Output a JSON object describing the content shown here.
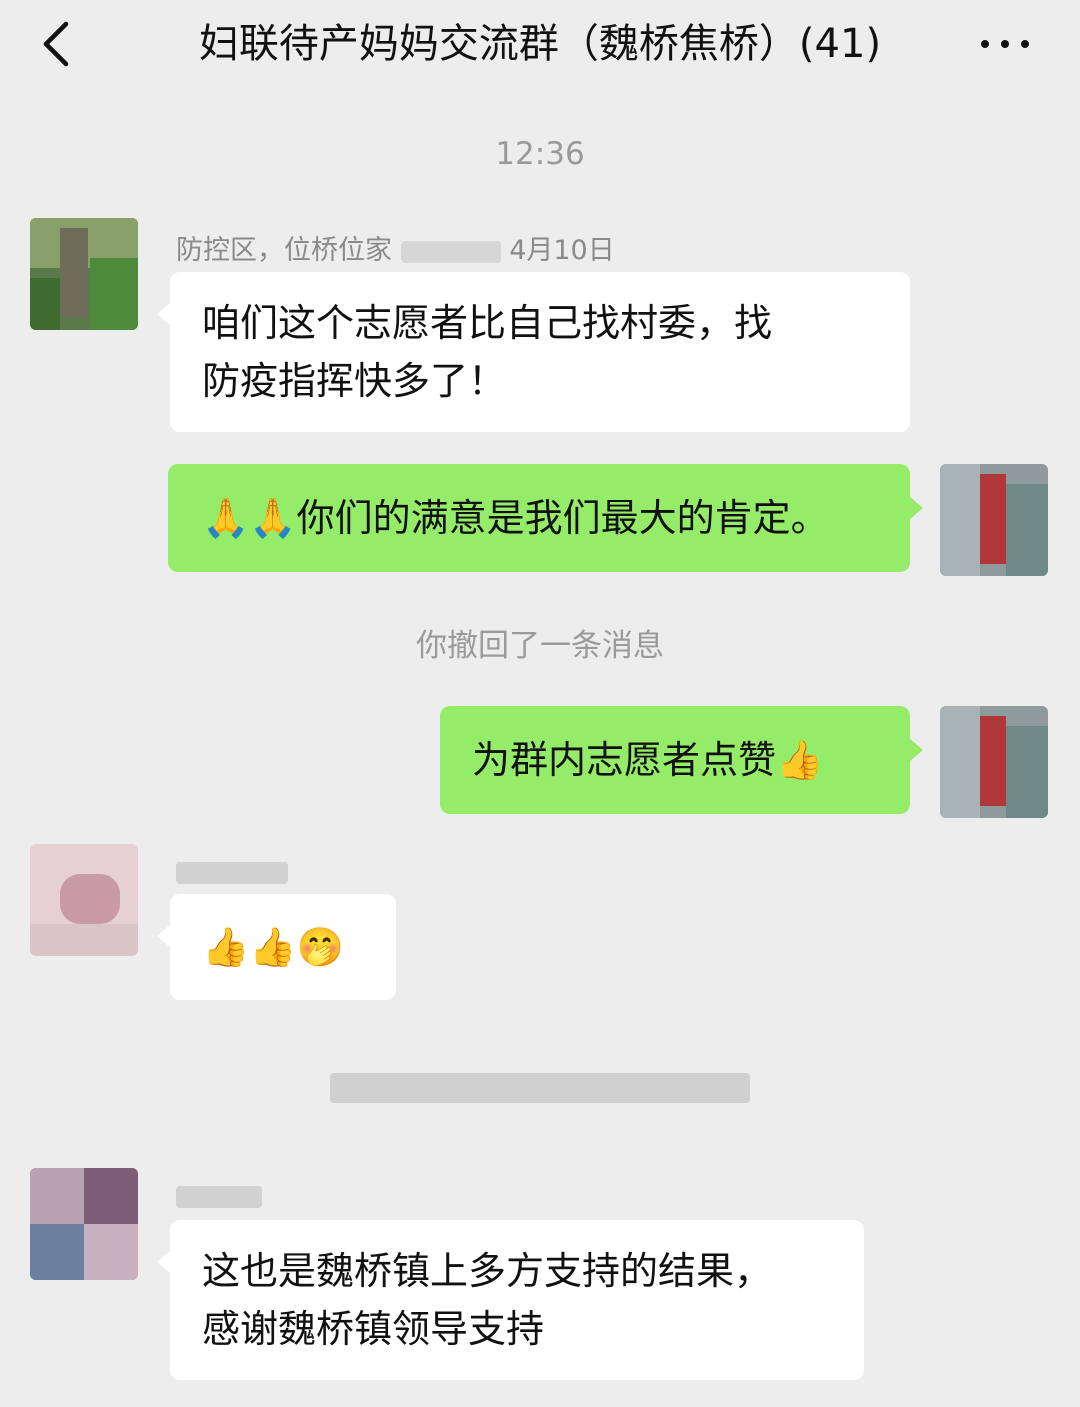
{
  "header": {
    "back_icon": "chevron-left-icon",
    "title": "妇联待产妈妈交流群（魏桥焦桥）(41)",
    "more_icon": "more-dots-icon"
  },
  "timestamp": "12:36",
  "messages": [
    {
      "side": "left",
      "sender": "防控区，位桥位家",
      "sender_suffix": "4月10日",
      "text_line1": "咱们这个志愿者比自己找村委，找",
      "text_line2": "防疫指挥快多了！"
    },
    {
      "side": "right",
      "emoji": "🙏🙏",
      "text": "你们的满意是我们最大的肯定。"
    },
    {
      "side": "right",
      "text": "为群内志愿者点赞",
      "emoji": "👍"
    },
    {
      "side": "left",
      "emoji": "👍👍🤭"
    },
    {
      "side": "left",
      "text_line1": "这也是魏桥镇上多方支持的结果，",
      "text_line2": "感谢魏桥镇领导支持"
    }
  ],
  "system": {
    "recall_notice": "你撤回了一条消息"
  },
  "colors": {
    "background": "#ededed",
    "bubble_self": "#95ec69",
    "bubble_other": "#ffffff"
  }
}
